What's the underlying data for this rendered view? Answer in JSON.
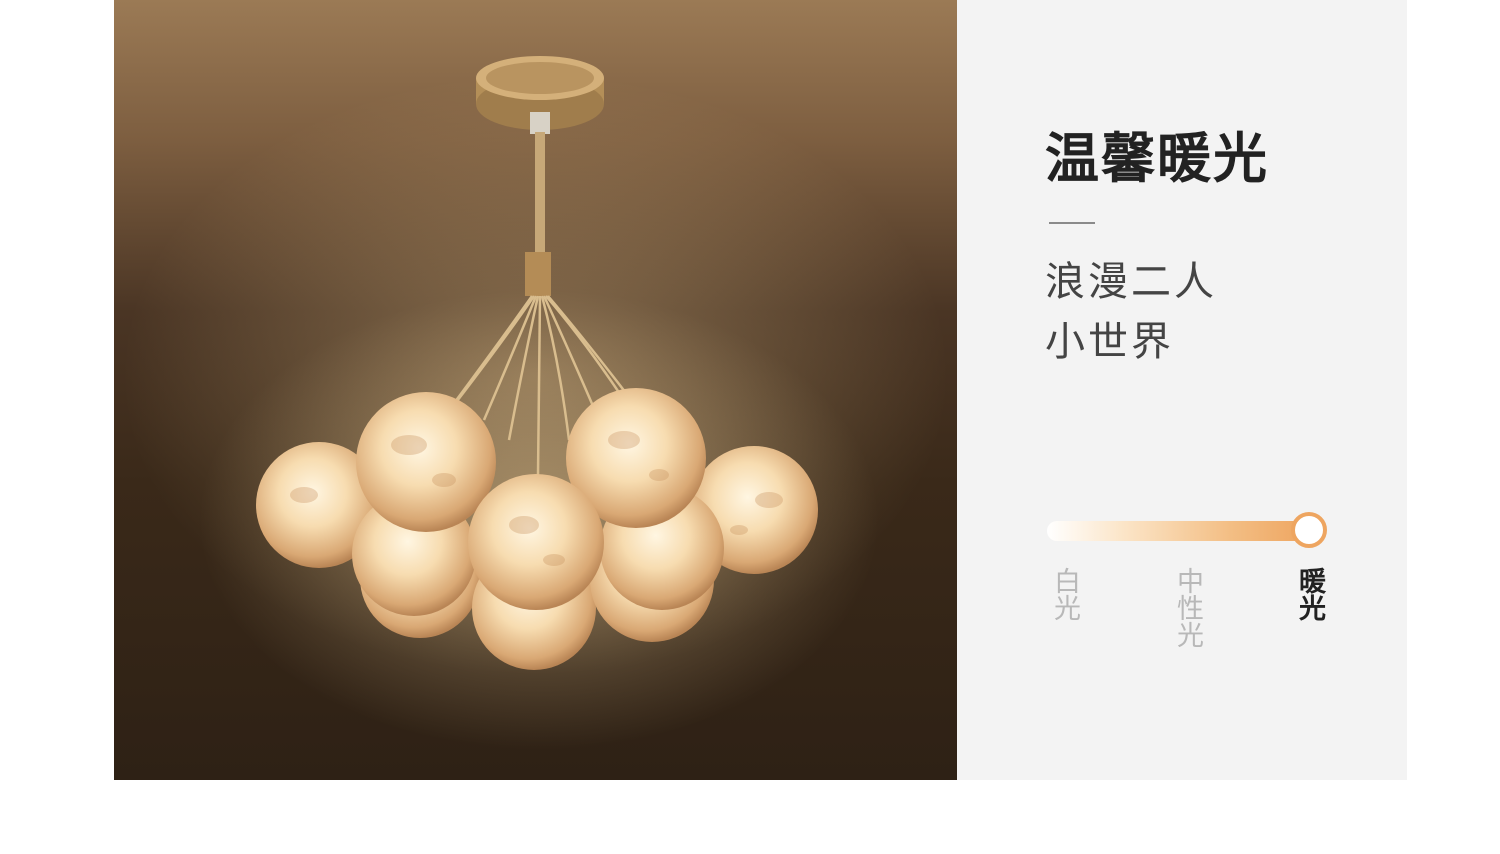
{
  "heading": "温馨暖光",
  "subtitle_lines": [
    "浪漫二人",
    "小世界"
  ],
  "color_temperature": {
    "options": [
      "白光",
      "中性光",
      "暖光"
    ],
    "selected": "暖光",
    "selected_index": 2,
    "level": 1.0
  },
  "colors": {
    "accent": "#eea560",
    "panel_bg": "#f3f3f3",
    "heading": "#222222",
    "inactive_label": "#b8b8b8"
  },
  "image": {
    "subject": "moon-globe-chandelier"
  }
}
